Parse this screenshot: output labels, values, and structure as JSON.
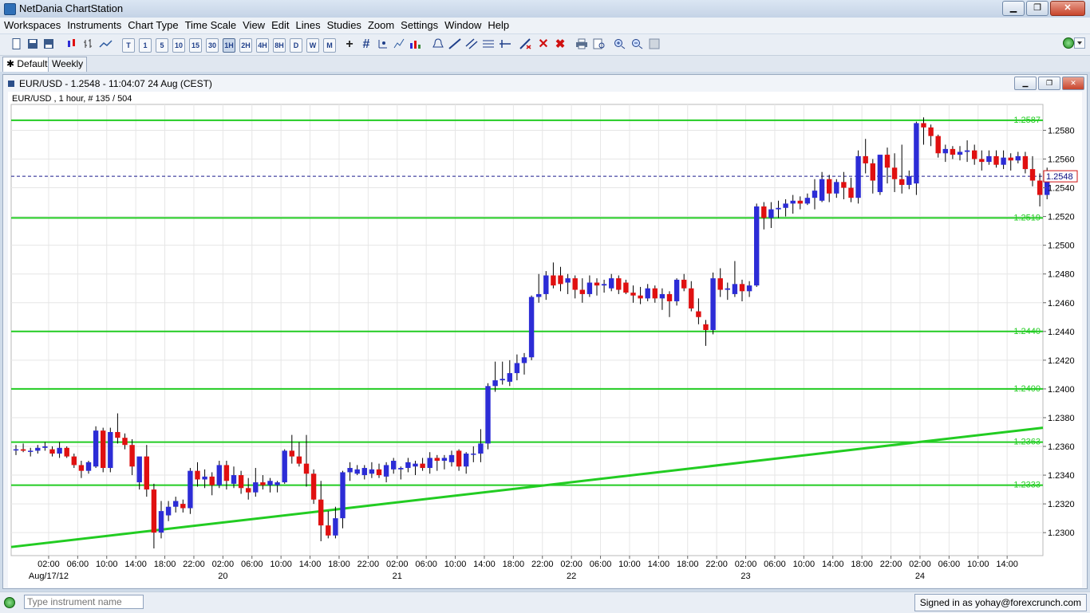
{
  "app": {
    "title": "NetDania ChartStation"
  },
  "menu": [
    "Workspaces",
    "Instruments",
    "Chart Type",
    "Time Scale",
    "View",
    "Edit",
    "Lines",
    "Studies",
    "Zoom",
    "Settings",
    "Window",
    "Help"
  ],
  "toolbar": {
    "intervals": [
      "T",
      "1",
      "5",
      "10",
      "15",
      "30",
      "1H",
      "2H",
      "4H",
      "8H",
      "D",
      "W",
      "M"
    ],
    "selected": "1H"
  },
  "tabs": [
    {
      "label": "Default",
      "active": true
    },
    {
      "label": "Weekly",
      "active": false
    }
  ],
  "chart_window": {
    "title": "EUR/USD - 1.2548 - 11:04:07  24 Aug (CEST)"
  },
  "status": {
    "instrument_placeholder": "Type instrument name",
    "signed_in": "Signed in as yohay@forexcrunch.com"
  },
  "colors": {
    "up": "#2c2cd6",
    "down": "#e01010",
    "level_line": "#22cc22",
    "current_line": "#1a1a8c"
  },
  "chart_data": {
    "type": "candlestick",
    "info_label": "EUR/USD , 1 hour, # 135 / 504",
    "current_price": "1.2548",
    "ylim": [
      1.2284,
      1.2598
    ],
    "y_ticks": [
      "1.2300",
      "1.2320",
      "1.2340",
      "1.2360",
      "1.2380",
      "1.2400",
      "1.2420",
      "1.2440",
      "1.2460",
      "1.2480",
      "1.2500",
      "1.2520",
      "1.2540",
      "1.2560",
      "1.2580"
    ],
    "levels": [
      "1.2587",
      "1.2519",
      "1.2440",
      "1.2400",
      "1.2363",
      "1.2333"
    ],
    "trendline": {
      "from": [
        "Aug 17 00:00",
        1.229
      ],
      "to": [
        "Aug 24 14:00",
        1.2373
      ]
    },
    "x_ticks": [
      {
        "label": "02:00",
        "bar": 4.5
      },
      {
        "label": "06:00",
        "bar": 8.5
      },
      {
        "label": "10:00",
        "bar": 12.5
      },
      {
        "label": "14:00",
        "bar": 16.5
      },
      {
        "label": "18:00",
        "bar": 20.5
      },
      {
        "label": "22:00",
        "bar": 24.5
      },
      {
        "label": "02:00",
        "bar": 28.5
      },
      {
        "label": "06:00",
        "bar": 32.5
      },
      {
        "label": "10:00",
        "bar": 36.5
      },
      {
        "label": "14:00",
        "bar": 40.5
      },
      {
        "label": "18:00",
        "bar": 44.5
      },
      {
        "label": "22:00",
        "bar": 48.5
      },
      {
        "label": "02:00",
        "bar": 52.5
      },
      {
        "label": "06:00",
        "bar": 56.5
      },
      {
        "label": "10:00",
        "bar": 60.5
      },
      {
        "label": "14:00",
        "bar": 64.5
      },
      {
        "label": "18:00",
        "bar": 68.5
      },
      {
        "label": "22:00",
        "bar": 72.5
      },
      {
        "label": "02:00",
        "bar": 76.5
      },
      {
        "label": "06:00",
        "bar": 80.5
      },
      {
        "label": "10:00",
        "bar": 84.5
      },
      {
        "label": "14:00",
        "bar": 88.5
      },
      {
        "label": "18:00",
        "bar": 92.5
      },
      {
        "label": "22:00",
        "bar": 96.5
      },
      {
        "label": "02:00",
        "bar": 100.5
      },
      {
        "label": "06:00",
        "bar": 104.5
      },
      {
        "label": "10:00",
        "bar": 108.5
      },
      {
        "label": "14:00",
        "bar": 112.5
      },
      {
        "label": "18:00",
        "bar": 116.5
      },
      {
        "label": "22:00",
        "bar": 120.5
      },
      {
        "label": "02:00",
        "bar": 124.5
      },
      {
        "label": "06:00",
        "bar": 128.5
      },
      {
        "label": "10:00",
        "bar": 132.5
      },
      {
        "label": "14:00",
        "bar": 136.5
      }
    ],
    "date_labels": [
      {
        "label": "Aug/17/12",
        "bar": 4.5
      },
      {
        "label": "20",
        "bar": 28.5
      },
      {
        "label": "21",
        "bar": 52.5
      },
      {
        "label": "22",
        "bar": 76.5
      },
      {
        "label": "23",
        "bar": 100.5
      },
      {
        "label": "24",
        "bar": 124.5
      }
    ],
    "candles": [
      [
        1.2358,
        1.2361,
        1.2354,
        1.2358
      ],
      [
        1.2358,
        1.2362,
        1.2356,
        1.2357
      ],
      [
        1.2357,
        1.2359,
        1.2353,
        1.2357
      ],
      [
        1.2357,
        1.2361,
        1.2355,
        1.2359
      ],
      [
        1.2359,
        1.2363,
        1.2357,
        1.236
      ],
      [
        1.2358,
        1.236,
        1.2353,
        1.2355
      ],
      [
        1.2355,
        1.2363,
        1.2352,
        1.2359
      ],
      [
        1.2359,
        1.236,
        1.2352,
        1.2353
      ],
      [
        1.2353,
        1.2355,
        1.2345,
        1.2347
      ],
      [
        1.2347,
        1.235,
        1.2338,
        1.2343
      ],
      [
        1.2343,
        1.235,
        1.2341,
        1.2349
      ],
      [
        1.2346,
        1.2374,
        1.2345,
        1.2371
      ],
      [
        1.2371,
        1.2373,
        1.2342,
        1.2345
      ],
      [
        1.2345,
        1.2373,
        1.2342,
        1.237
      ],
      [
        1.237,
        1.2383,
        1.2362,
        1.2366
      ],
      [
        1.2366,
        1.2369,
        1.2358,
        1.2361
      ],
      [
        1.2361,
        1.2365,
        1.234,
        1.2346
      ],
      [
        1.2335,
        1.2352,
        1.233,
        1.2353
      ],
      [
        1.2353,
        1.2361,
        1.2325,
        1.233
      ],
      [
        1.233,
        1.2334,
        1.2289,
        1.23
      ],
      [
        1.23,
        1.2322,
        1.2296,
        1.2315
      ],
      [
        1.2312,
        1.2322,
        1.2308,
        1.2318
      ],
      [
        1.2318,
        1.2325,
        1.2314,
        1.2322
      ],
      [
        1.232,
        1.2323,
        1.2314,
        1.2317
      ],
      [
        1.2317,
        1.2345,
        1.2313,
        1.2343
      ],
      [
        1.2343,
        1.2349,
        1.2332,
        1.2337
      ],
      [
        1.2337,
        1.2344,
        1.2331,
        1.2339
      ],
      [
        1.2339,
        1.2342,
        1.2326,
        1.2333
      ],
      [
        1.2333,
        1.235,
        1.2331,
        1.2347
      ],
      [
        1.2347,
        1.235,
        1.233,
        1.2336
      ],
      [
        1.2334,
        1.2346,
        1.2331,
        1.234
      ],
      [
        1.234,
        1.2343,
        1.2327,
        1.2331
      ],
      [
        1.2331,
        1.2338,
        1.2323,
        1.2328
      ],
      [
        1.2328,
        1.2345,
        1.2325,
        1.2335
      ],
      [
        1.2335,
        1.234,
        1.233,
        1.2333
      ],
      [
        1.2333,
        1.2338,
        1.2328,
        1.2336
      ],
      [
        1.2333,
        1.2336,
        1.2328,
        1.2335
      ],
      [
        1.2335,
        1.2358,
        1.2334,
        1.2357
      ],
      [
        1.2357,
        1.2368,
        1.2348,
        1.2353
      ],
      [
        1.2353,
        1.2363,
        1.2346,
        1.2348
      ],
      [
        1.2348,
        1.2368,
        1.2332,
        1.2341
      ],
      [
        1.2341,
        1.2344,
        1.232,
        1.2323
      ],
      [
        1.2323,
        1.2336,
        1.2294,
        1.2305
      ],
      [
        1.2305,
        1.2315,
        1.2296,
        1.2298
      ],
      [
        1.2298,
        1.2318,
        1.2296,
        1.231
      ],
      [
        1.231,
        1.2343,
        1.2303,
        1.2342
      ],
      [
        1.2342,
        1.2349,
        1.2336,
        1.2345
      ],
      [
        1.2341,
        1.2347,
        1.234,
        1.2344
      ],
      [
        1.234,
        1.2347,
        1.2337,
        1.2345
      ],
      [
        1.2341,
        1.2349,
        1.2338,
        1.2344
      ],
      [
        1.2344,
        1.2348,
        1.2338,
        1.234
      ],
      [
        1.2339,
        1.2349,
        1.2335,
        1.2347
      ],
      [
        1.2344,
        1.2352,
        1.2341,
        1.235
      ],
      [
        1.2344,
        1.2346,
        1.2337,
        1.2345
      ],
      [
        1.2345,
        1.2352,
        1.2342,
        1.2349
      ],
      [
        1.2346,
        1.235,
        1.234,
        1.2348
      ],
      [
        1.2348,
        1.2352,
        1.2343,
        1.2345
      ],
      [
        1.2345,
        1.2356,
        1.2341,
        1.2352
      ],
      [
        1.2352,
        1.2354,
        1.2343,
        1.235
      ],
      [
        1.235,
        1.2354,
        1.2344,
        1.2352
      ],
      [
        1.2349,
        1.2357,
        1.2346,
        1.2354
      ],
      [
        1.2357,
        1.2358,
        1.2343,
        1.2346
      ],
      [
        1.2346,
        1.2356,
        1.2341,
        1.2355
      ],
      [
        1.2355,
        1.236,
        1.2349,
        1.2355
      ],
      [
        1.2355,
        1.2372,
        1.2349,
        1.2362
      ],
      [
        1.2362,
        1.2404,
        1.2358,
        1.2402
      ],
      [
        1.2402,
        1.2419,
        1.2398,
        1.2406
      ],
      [
        1.2406,
        1.2419,
        1.2403,
        1.2407
      ],
      [
        1.2405,
        1.242,
        1.2402,
        1.2411
      ],
      [
        1.2411,
        1.2424,
        1.2406,
        1.2418
      ],
      [
        1.2418,
        1.2425,
        1.241,
        1.2422
      ],
      [
        1.2422,
        1.2465,
        1.242,
        1.2464
      ],
      [
        1.2464,
        1.248,
        1.246,
        1.2466
      ],
      [
        1.2466,
        1.2482,
        1.2462,
        1.2479
      ],
      [
        1.2479,
        1.2488,
        1.247,
        1.2472
      ],
      [
        1.2479,
        1.2485,
        1.2468,
        1.2473
      ],
      [
        1.2474,
        1.248,
        1.2466,
        1.2477
      ],
      [
        1.2477,
        1.2479,
        1.2463,
        1.2469
      ],
      [
        1.2469,
        1.2477,
        1.246,
        1.2466
      ],
      [
        1.2466,
        1.2479,
        1.2464,
        1.2474
      ],
      [
        1.2474,
        1.2477,
        1.2465,
        1.2472
      ],
      [
        1.2472,
        1.2476,
        1.2467,
        1.2473
      ],
      [
        1.247,
        1.248,
        1.2468,
        1.2477
      ],
      [
        1.2477,
        1.2479,
        1.2466,
        1.2469
      ],
      [
        1.2474,
        1.2476,
        1.2466,
        1.2467
      ],
      [
        1.2467,
        1.2472,
        1.246,
        1.2465
      ],
      [
        1.2465,
        1.2471,
        1.2459,
        1.2463
      ],
      [
        1.2463,
        1.2473,
        1.2461,
        1.247
      ],
      [
        1.247,
        1.2472,
        1.246,
        1.2463
      ],
      [
        1.2463,
        1.247,
        1.2455,
        1.2466
      ],
      [
        1.2466,
        1.2468,
        1.245,
        1.2461
      ],
      [
        1.2461,
        1.2477,
        1.2458,
        1.2476
      ],
      [
        1.2476,
        1.248,
        1.2468,
        1.247
      ],
      [
        1.247,
        1.2475,
        1.2454,
        1.2456
      ],
      [
        1.2454,
        1.2463,
        1.2445,
        1.245
      ],
      [
        1.2445,
        1.2448,
        1.243,
        1.2441
      ],
      [
        1.2441,
        1.2481,
        1.2438,
        1.2477
      ],
      [
        1.2477,
        1.2484,
        1.2464,
        1.2469
      ],
      [
        1.2469,
        1.2474,
        1.2462,
        1.247
      ],
      [
        1.2466,
        1.2489,
        1.2464,
        1.2473
      ],
      [
        1.2473,
        1.2476,
        1.2461,
        1.2468
      ],
      [
        1.2468,
        1.2475,
        1.2464,
        1.2472
      ],
      [
        1.2472,
        1.2529,
        1.2471,
        1.2527
      ],
      [
        1.2527,
        1.253,
        1.2511,
        1.2519
      ],
      [
        1.2519,
        1.253,
        1.2512,
        1.2525
      ],
      [
        1.2525,
        1.2531,
        1.2519,
        1.2526
      ],
      [
        1.2526,
        1.2532,
        1.252,
        1.2529
      ],
      [
        1.2529,
        1.2535,
        1.2522,
        1.2531
      ],
      [
        1.2531,
        1.2534,
        1.2525,
        1.2529
      ],
      [
        1.2529,
        1.2536,
        1.2528,
        1.2533
      ],
      [
        1.2533,
        1.2546,
        1.2525,
        1.2538
      ],
      [
        1.2531,
        1.2551,
        1.253,
        1.2546
      ],
      [
        1.2546,
        1.2549,
        1.253,
        1.2536
      ],
      [
        1.2536,
        1.2546,
        1.2533,
        1.2544
      ],
      [
        1.2544,
        1.2551,
        1.2532,
        1.254
      ],
      [
        1.254,
        1.2547,
        1.253,
        1.2533
      ],
      [
        1.2533,
        1.2566,
        1.2529,
        1.2562
      ],
      [
        1.2562,
        1.2574,
        1.255,
        1.2557
      ],
      [
        1.2557,
        1.256,
        1.2536,
        1.2545
      ],
      [
        1.2537,
        1.2563,
        1.2535,
        1.2563
      ],
      [
        1.2563,
        1.2568,
        1.2543,
        1.2554
      ],
      [
        1.2554,
        1.2564,
        1.2537,
        1.2546
      ],
      [
        1.2546,
        1.257,
        1.2536,
        1.2542
      ],
      [
        1.2542,
        1.2552,
        1.2539,
        1.2548
      ],
      [
        1.2543,
        1.2586,
        1.2535,
        1.2585
      ],
      [
        1.2585,
        1.2589,
        1.257,
        1.2582
      ],
      [
        1.2582,
        1.2584,
        1.2569,
        1.2576
      ],
      [
        1.2576,
        1.2577,
        1.2561,
        1.2564
      ],
      [
        1.2564,
        1.257,
        1.2558,
        1.2567
      ],
      [
        1.2567,
        1.2569,
        1.256,
        1.2563
      ],
      [
        1.2563,
        1.2569,
        1.2559,
        1.2565
      ],
      [
        1.2565,
        1.2573,
        1.2558,
        1.2566
      ],
      [
        1.2566,
        1.257,
        1.2556,
        1.256
      ],
      [
        1.256,
        1.2566,
        1.2552,
        1.2558
      ],
      [
        1.2558,
        1.2566,
        1.2556,
        1.2562
      ],
      [
        1.2562,
        1.2566,
        1.2554,
        1.2556
      ],
      [
        1.2556,
        1.2566,
        1.2553,
        1.2561
      ],
      [
        1.2561,
        1.2564,
        1.2552,
        1.2559
      ],
      [
        1.2559,
        1.2565,
        1.2557,
        1.2562
      ],
      [
        1.2562,
        1.2565,
        1.255,
        1.2553
      ],
      [
        1.2553,
        1.2562,
        1.2541,
        1.2545
      ],
      [
        1.2545,
        1.255,
        1.2527,
        1.2535
      ],
      [
        1.2535,
        1.2554,
        1.2532,
        1.2545
      ],
      [
        1.2545,
        1.2549,
        1.2544,
        1.2548
      ]
    ]
  }
}
